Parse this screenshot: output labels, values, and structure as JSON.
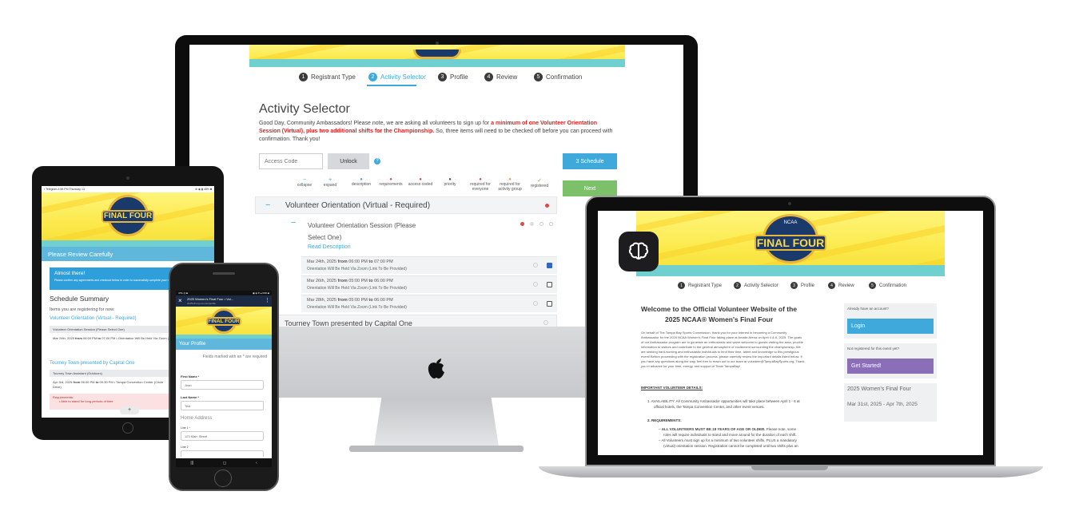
{
  "monitor": {
    "steps": [
      {
        "num": "1",
        "label": "Registrant Type"
      },
      {
        "num": "2",
        "label": "Activity Selector"
      },
      {
        "num": "3",
        "label": "Profile"
      },
      {
        "num": "4",
        "label": "Review"
      },
      {
        "num": "5",
        "label": "Confirmation"
      }
    ],
    "title": "Activity Selector",
    "intro_plain": "Good Day, Community Ambassadors! Please note, we are asking all volunteers to sign up for ",
    "intro_bold_red": "a minimum of one Volunteer Orientation Session (Virtual), plus two additional shifts for the Championship.",
    "intro_tail": " So, three items will need to be checked off before you can proceed with confirmation. Thank you!",
    "access_code_placeholder": "Access Code",
    "unlock_label": "Unlock",
    "help_icon": "?",
    "schedule_label": "3 Schedule",
    "next_label": "Next",
    "legend": [
      {
        "icon": "−",
        "label": "collapse",
        "color": "#3fa9dc"
      },
      {
        "icon": "+",
        "label": "expand",
        "color": "#3fa9dc"
      },
      {
        "icon": "●",
        "label": "description",
        "color": "#3fa9dc"
      },
      {
        "icon": "●",
        "label": "requirements",
        "color": "#e04848"
      },
      {
        "icon": "●",
        "label": "access coded",
        "color": "#e04848"
      },
      {
        "icon": "●",
        "label": "priority",
        "color": "#555"
      },
      {
        "icon": "●",
        "label": "required for everyone",
        "color": "#e04848"
      },
      {
        "icon": "●",
        "label": "required for activity group",
        "color": "#e8a040"
      },
      {
        "icon": "✓",
        "label": "registered",
        "color": "#6ab04c"
      }
    ],
    "group_title": "Volunteer Orientation (Virtual - Required)",
    "group_toggle": "−",
    "session_toggle": "−",
    "session_title_1": "Volunteer Orientation Session (Please",
    "session_title_2": "Select One)",
    "read_description": "Read Description",
    "shifts": [
      {
        "date": "Mar 24th, 2025",
        "from": "from",
        "start": "06:00 PM",
        "to": "to",
        "end": "07:00 PM",
        "note": "Orientation Will Be Held Via Zoom (Link To Be Provided)",
        "checked": true
      },
      {
        "date": "Mar 26th, 2025",
        "from": "from",
        "start": "05:00 PM",
        "to": "to",
        "end": "06:00 PM",
        "note": "Orientation Will Be Held Via Zoom (Link To Be Provided)",
        "checked": false
      },
      {
        "date": "Mar 28th, 2025",
        "from": "from",
        "start": "05:00 PM",
        "to": "to",
        "end": "06:00 PM",
        "note": "Orientation Will Be Held Via Zoom (Link To Be Provided)",
        "checked": false
      }
    ],
    "next_group": "Tourney Town presented by Capital One"
  },
  "tablet": {
    "status_left": "▪ Telegram  4:58 PM  Thursday 13",
    "status_right": "⊕ ◉ ▮ 48% ■",
    "logo_text": "FINAL FOUR",
    "page_heading": "Please Review Carefully",
    "alert_title": "Almost there!",
    "alert_body": "Please confirm any agreements and checkout below in order to successfully complete your registration.",
    "summary_title": "Schedule Summary",
    "summary_sub": "Items you are registering for now:",
    "group1": "Volunteer Orientation (Virtual - Required)",
    "group1_row": "Volunteer Orientation Session (Please Select One)",
    "group1_detail_date": "Mar 24th, 2025",
    "group1_detail_from": "from",
    "group1_detail_start": "06:00 PM",
    "group1_detail_to": "to",
    "group1_detail_rest": "07:00 PM • Orientation Will Be Held Via Zoom (Link To Be Provided)",
    "group2": "Tourney Town presented by Capital One",
    "group2_row": "Tourney Town Assistant (Outdoors)",
    "group2_detail_date": "Apr 3rd, 2025",
    "group2_detail_from": "from",
    "group2_detail_start": "06:00 PM",
    "group2_detail_to": "to",
    "group2_detail_rest": "09:30 PM • Tampa Convention Center (Circle Drive)",
    "req_title": "Requirements:",
    "req_item": "Able to stand for long periods of time",
    "plus": "+"
  },
  "phone": {
    "status_left": "4:51 ◎ ■",
    "status_right": "◉ ◈ ✆ ▴ 64% ■",
    "close": "×",
    "tab_title": "2025 Women's Final Four • Vol...",
    "tab_url": "2025wff.org.ms.com/profile",
    "logo_text": "FINAL FOUR",
    "heading": "Your Profile",
    "required_note": "Fields marked with an * are required",
    "first_name_label": "First Name *",
    "first_name": "Jean",
    "last_name_label": "Last Name *",
    "last_name": "Test",
    "home_address": "Home Address",
    "line1_label": "Line 1 *",
    "line1": "123 Main Street",
    "line2_label": "Line 2",
    "nav": [
      "|||",
      "◻",
      "‹"
    ]
  },
  "laptop": {
    "logo_text": "FINAL FOUR",
    "steps": [
      {
        "num": "1",
        "label": "Registrant Type"
      },
      {
        "num": "2",
        "label": "Activity Selector"
      },
      {
        "num": "3",
        "label": "Profile"
      },
      {
        "num": "4",
        "label": "Review"
      },
      {
        "num": "5",
        "label": "Confirmation"
      }
    ],
    "welcome_1": "Welcome to the Official Volunteer Website of the",
    "welcome_2": "2025 NCAA® Women's Final Four",
    "body_1": "On behalf of The Tampa Bay Sports Commission, thank you for your interest in becoming a Community",
    "body_2": "Ambassador for the 2025 NCAA Women's Final Four taking place at Amalie Arena on April 4 & 6, 2025. The goals",
    "body_3": "of our Ambassador program are to generate an enthusiastic and warm welcome to guests visiting the area, provide",
    "body_4": "information to visitors and contribute to the general atmosphere of excitement surrounding the championship. We",
    "body_5": "are seeking hard-working and enthusiastic individuals to lend their time, talent and knowledge to this prestigious",
    "body_6": "event! Before proceeding with the registration process, please carefully review the important details listed below. If",
    "body_7": "you have any questions along the way, feel free to reach out to our team at volunteer@TampaBaySports.org. Thank",
    "body_8": "you in advance for your time, energy, and support of Team TampaBay!",
    "details_heading": "IMPORTANT VOLUNTEER DETAILS:",
    "avail_1": "1. AVAILABILITY: All Community Ambassador opportunities will take place between April 1 - 6 at",
    "avail_2": "official hotels, the Tampa Convention Center, and other event venues.",
    "req_heading": "2. REQUIREMENTS:",
    "req_1a": "ALL VOLUNTEERS MUST BE 18 YEARS OF AGE OR OLDER.",
    "req_1b": " Please note, some",
    "req_1c": "roles will require individuals to stand and move around for the duration of each shift.",
    "req_2": "– All Volunteers must sign up for a minimum of two volunteer shifts, PLUS a mandatory",
    "req_3": "(virtual) orientation session. Registration cannot be completed until two shifts plus an",
    "have_account": "Already have an account?",
    "login": "Login",
    "not_registered": "Not registered for this event yet?",
    "get_started": "Get Started!",
    "event_name": "2025 Women's Final Four",
    "event_dates": "Mar 31st, 2025 - Apr 7th, 2025",
    "app_icon": "brain-icon"
  }
}
